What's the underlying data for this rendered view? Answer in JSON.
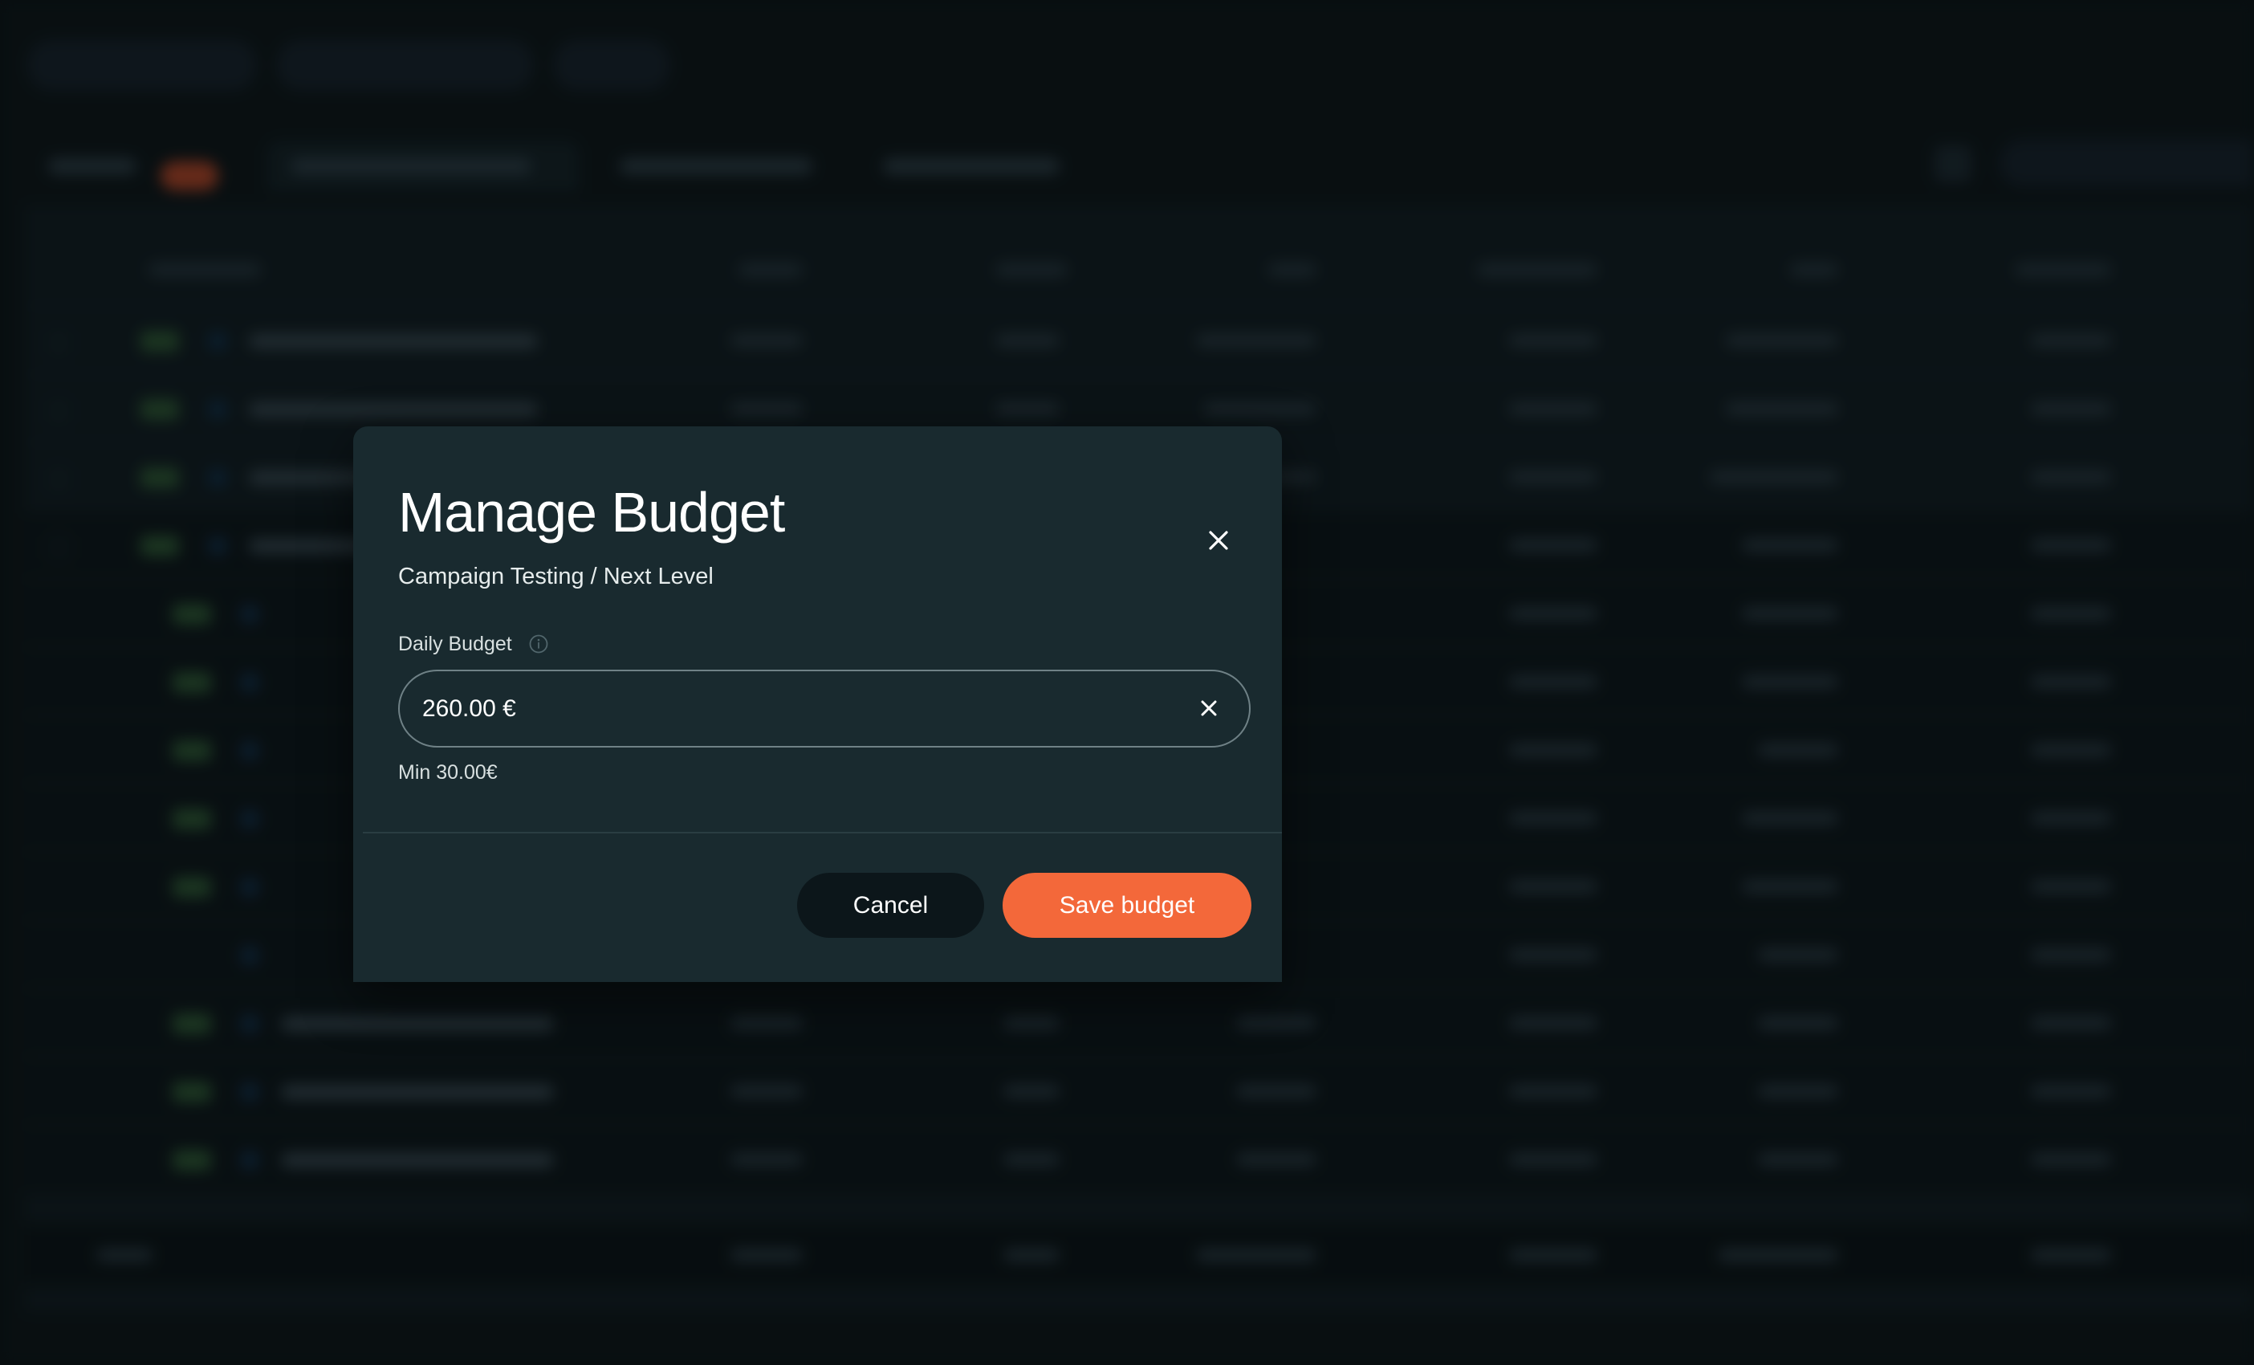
{
  "modal": {
    "title": "Manage Budget",
    "subtitle": "Campaign Testing / Next Level",
    "field_label": "Daily Budget",
    "field_value": "260.00 €",
    "min_hint": "Min 30.00€",
    "cancel_label": "Cancel",
    "save_label": "Save budget",
    "icons": {
      "close": "close-icon",
      "info": "info-icon",
      "clear": "clear-icon"
    }
  },
  "colors": {
    "accent": "#f3683a",
    "modal_bg": "#192a2f",
    "cancel_bg": "#0c161a",
    "backdrop": "#0b1214"
  }
}
